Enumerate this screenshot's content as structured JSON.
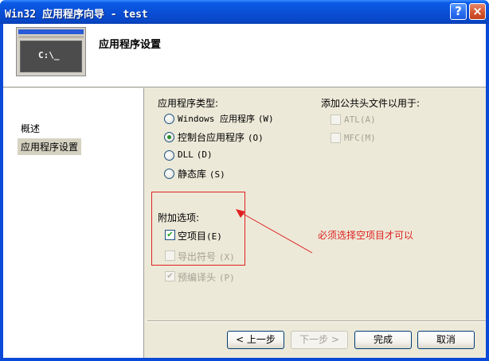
{
  "window": {
    "title": "Win32 应用程序向导 - test",
    "help_label": "?",
    "close_label": "×"
  },
  "header": {
    "title": "应用程序设置",
    "thumbnail_prompt": "C:\\_"
  },
  "sidebar": {
    "items": [
      {
        "label": "概述"
      },
      {
        "label": "应用程序设置",
        "selected": true
      }
    ]
  },
  "app_type": {
    "label": "应用程序类型:",
    "options": [
      {
        "label": "Windows 应用程序",
        "mnemonic": "(W)",
        "selected": false
      },
      {
        "label": "控制台应用程序",
        "mnemonic": "(O)",
        "selected": true
      },
      {
        "label": "DLL",
        "mnemonic": "(D)",
        "selected": false
      },
      {
        "label": "静态库",
        "mnemonic": "(S)",
        "selected": false
      }
    ]
  },
  "common_headers": {
    "label": "添加公共头文件以用于:",
    "options": [
      {
        "label": "ATL",
        "mnemonic": "(A)",
        "checked": false,
        "enabled": false
      },
      {
        "label": "MFC",
        "mnemonic": "(M)",
        "checked": false,
        "enabled": false
      }
    ]
  },
  "additional_options": {
    "label": "附加选项:",
    "options": [
      {
        "label": "空项目",
        "mnemonic": "(E)",
        "checked": true,
        "enabled": true
      },
      {
        "label": "导出符号",
        "mnemonic": "(X)",
        "checked": false,
        "enabled": false
      },
      {
        "label": "预编译头",
        "mnemonic": "(P)",
        "checked": true,
        "enabled": false
      }
    ]
  },
  "annotation": {
    "text": "必须选择空项目才可以",
    "color": "#e02020"
  },
  "buttons": {
    "back": "< 上一步",
    "next": "下一步 >",
    "finish": "完成",
    "cancel": "取消"
  },
  "colors": {
    "titlebar": "#0a4fd6",
    "dialog_bg": "#ece9d8",
    "button_border": "#003c74"
  }
}
